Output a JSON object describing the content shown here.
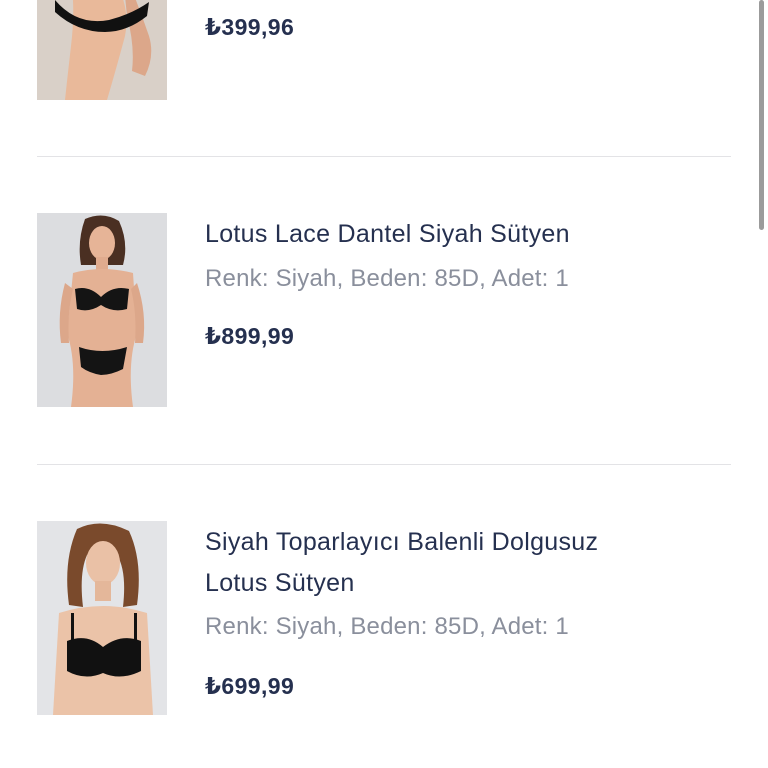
{
  "products": [
    {
      "title": "",
      "meta": "",
      "price": "₺399,96",
      "image": "model-lingerie-photo"
    },
    {
      "title": "Lotus Lace Dantel Siyah Sütyen",
      "meta": "Renk: Siyah, Beden: 85D, Adet: 1",
      "price": "₺899,99",
      "image": "model-lace-bra-photo"
    },
    {
      "title_line1": "Siyah Toparlayıcı Balenli Dolgusuz",
      "title_line2": "Lotus Sütyen",
      "meta": "Renk: Siyah, Beden: 85D, Adet: 1",
      "price": "₺699,99",
      "image": "model-strapless-bra-photo"
    }
  ]
}
